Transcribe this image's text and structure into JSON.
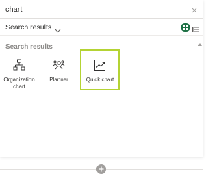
{
  "search": {
    "value": "chart",
    "clear_icon": "close-icon"
  },
  "filter": {
    "label": "Search results",
    "chevron_icon": "chevron-down-icon"
  },
  "view_toggle": {
    "active": "grid",
    "active_color": "#1e7145"
  },
  "results": {
    "heading": "Search results",
    "items": [
      {
        "label": "Organization chart",
        "icon": "org-chart-icon",
        "selected": false
      },
      {
        "label": "Planner",
        "icon": "planner-icon",
        "selected": false
      },
      {
        "label": "Quick chart",
        "icon": "line-chart-icon",
        "selected": true
      }
    ]
  },
  "colors": {
    "selection_border": "#b4d334",
    "text": "#323130",
    "muted": "#8a8886"
  }
}
